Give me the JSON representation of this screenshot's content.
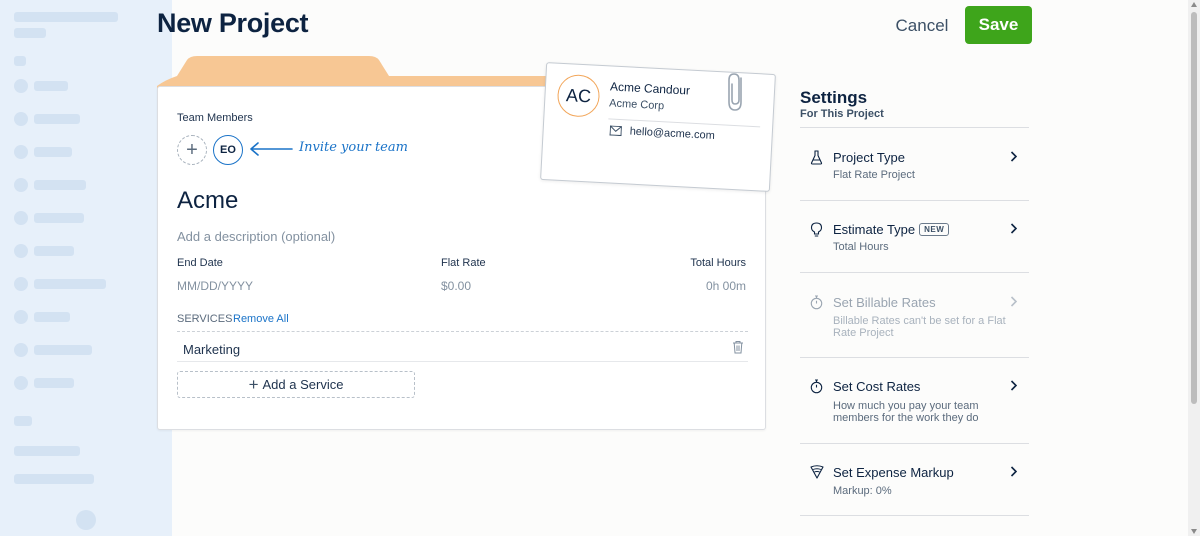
{
  "header": {
    "title": "New Project",
    "cancel_label": "Cancel",
    "save_label": "Save"
  },
  "project": {
    "team_label": "Team Members",
    "members": [
      "EO"
    ],
    "invite_text": "Invite your team",
    "name": "Acme",
    "description_placeholder": "Add a description (optional)",
    "end_date_label": "End Date",
    "end_date_placeholder": "MM/DD/YYYY",
    "flat_rate_label": "Flat Rate",
    "flat_rate_value": "$0.00",
    "total_hours_label": "Total Hours",
    "total_hours_value": "0h 00m",
    "services_label": "SERVICES",
    "remove_all_label": "Remove All",
    "services": [
      "Marketing"
    ],
    "add_service_label": "Add a Service"
  },
  "client": {
    "initials": "AC",
    "name": "Acme Candour",
    "company": "Acme Corp",
    "email": "hello@acme.com"
  },
  "settings": {
    "title": "Settings",
    "subtitle": "For This Project",
    "items": [
      {
        "title": "Project Type",
        "desc": "Flat Rate Project",
        "icon": "flask-icon",
        "disabled": false
      },
      {
        "title": "Estimate Type",
        "badge": "NEW",
        "desc": "Total Hours",
        "icon": "lightbulb-icon",
        "disabled": false
      },
      {
        "title": "Set Billable Rates",
        "desc": "Billable Rates can't be set for a Flat Rate Project",
        "icon": "stopwatch-icon",
        "disabled": true
      },
      {
        "title": "Set Cost Rates",
        "desc": "How much you pay your team members for the work they do",
        "icon": "stopwatch-icon",
        "disabled": false
      },
      {
        "title": "Set Expense Markup",
        "desc": "Markup: 0%",
        "icon": "markup-tag-icon",
        "disabled": false
      }
    ]
  },
  "colors": {
    "accent": "#1a73c8",
    "save_green": "#3ea51b",
    "folder_tab": "#f7c794",
    "client_ring": "#f2a65a",
    "text_dark": "#0d2341"
  }
}
